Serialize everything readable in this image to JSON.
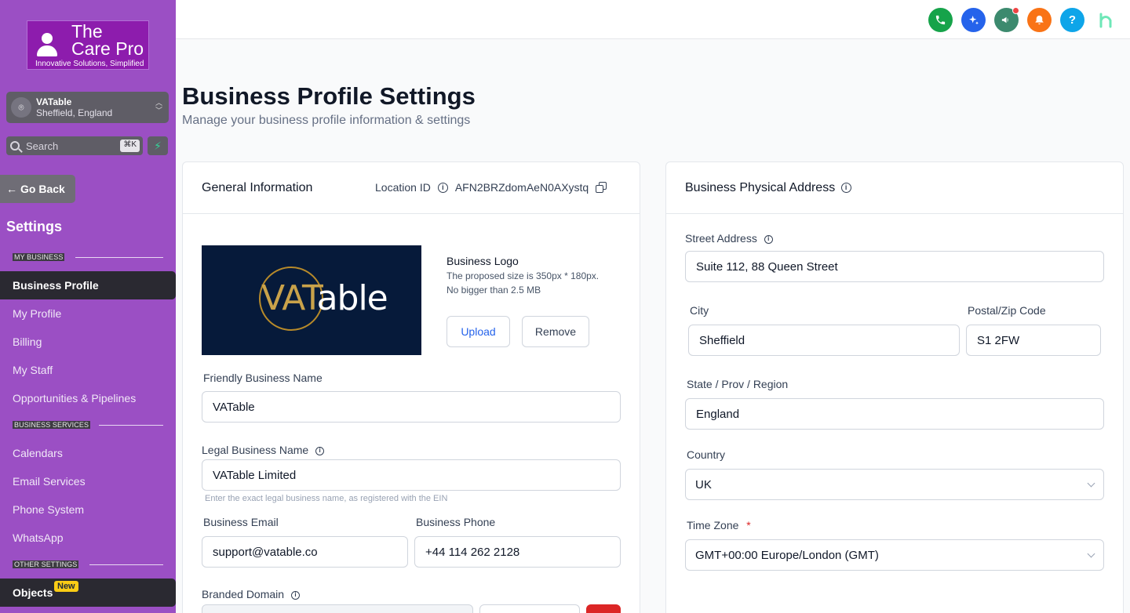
{
  "brand": {
    "name_line1": "The",
    "name_line2": "Care Pro",
    "tagline": "Innovative Solutions, Simplified"
  },
  "location_switcher": {
    "name": "VATable",
    "sub": "Sheffield, England"
  },
  "search": {
    "placeholder": "Search",
    "shortcut": "⌘K"
  },
  "sidebar": {
    "go_back": "Go Back",
    "settings_title": "Settings",
    "sections": {
      "my_business": "MY BUSINESS",
      "business_services": "BUSINESS SERVICES",
      "other_settings": "OTHER SETTINGS"
    },
    "items": {
      "business_profile": "Business Profile",
      "my_profile": "My Profile",
      "billing": "Billing",
      "my_staff": "My Staff",
      "opportunities": "Opportunities & Pipelines",
      "calendars": "Calendars",
      "email_services": "Email Services",
      "phone_system": "Phone System",
      "whatsapp": "WhatsApp",
      "objects": "Objects"
    },
    "new_badge": "New"
  },
  "topbar": {
    "icons": [
      "phone-icon",
      "sparkle-icon",
      "megaphone-icon",
      "bell-icon",
      "help-icon",
      "app-logo-icon"
    ],
    "colors": {
      "phone": "#16a34a",
      "sparkle": "#2563eb",
      "megaphone": "#3c8a6e",
      "bell": "#f97316",
      "help": "#0ea5e9"
    },
    "help_glyph": "?"
  },
  "page": {
    "title": "Business Profile Settings",
    "subtitle": "Manage your business profile information & settings"
  },
  "general": {
    "title": "General Information",
    "location_id_label": "Location ID",
    "location_id": "AFN2BRZdomAeN0AXystq",
    "logo_title": "Business Logo",
    "logo_hint1": "The proposed size is 350px * 180px.",
    "logo_hint2": "No bigger than 2.5 MB",
    "upload": "Upload",
    "remove": "Remove",
    "logo_image_text_gold": "VAT",
    "logo_image_text_white": "able",
    "friendly_name_label": "Friendly Business Name",
    "friendly_name": "VATable",
    "legal_name_label": "Legal Business Name",
    "legal_name": "VATable Limited",
    "legal_hint": "Enter the exact legal business name, as registered with the EIN",
    "email_label": "Business Email",
    "email": "support@vatable.co",
    "phone_label": "Business Phone",
    "phone": "+44 114 262 2128",
    "branded_domain_label": "Branded Domain"
  },
  "address": {
    "title": "Business Physical Address",
    "street_label": "Street Address",
    "street": "Suite 112, 88 Queen Street",
    "city_label": "City",
    "city": "Sheffield",
    "postal_label": "Postal/Zip Code",
    "postal": "S1 2FW",
    "state_label": "State / Prov / Region",
    "state": "England",
    "country_label": "Country",
    "country": "UK",
    "timezone_label": "Time Zone",
    "required_mark": "*",
    "timezone": "GMT+00:00 Europe/London (GMT)"
  }
}
